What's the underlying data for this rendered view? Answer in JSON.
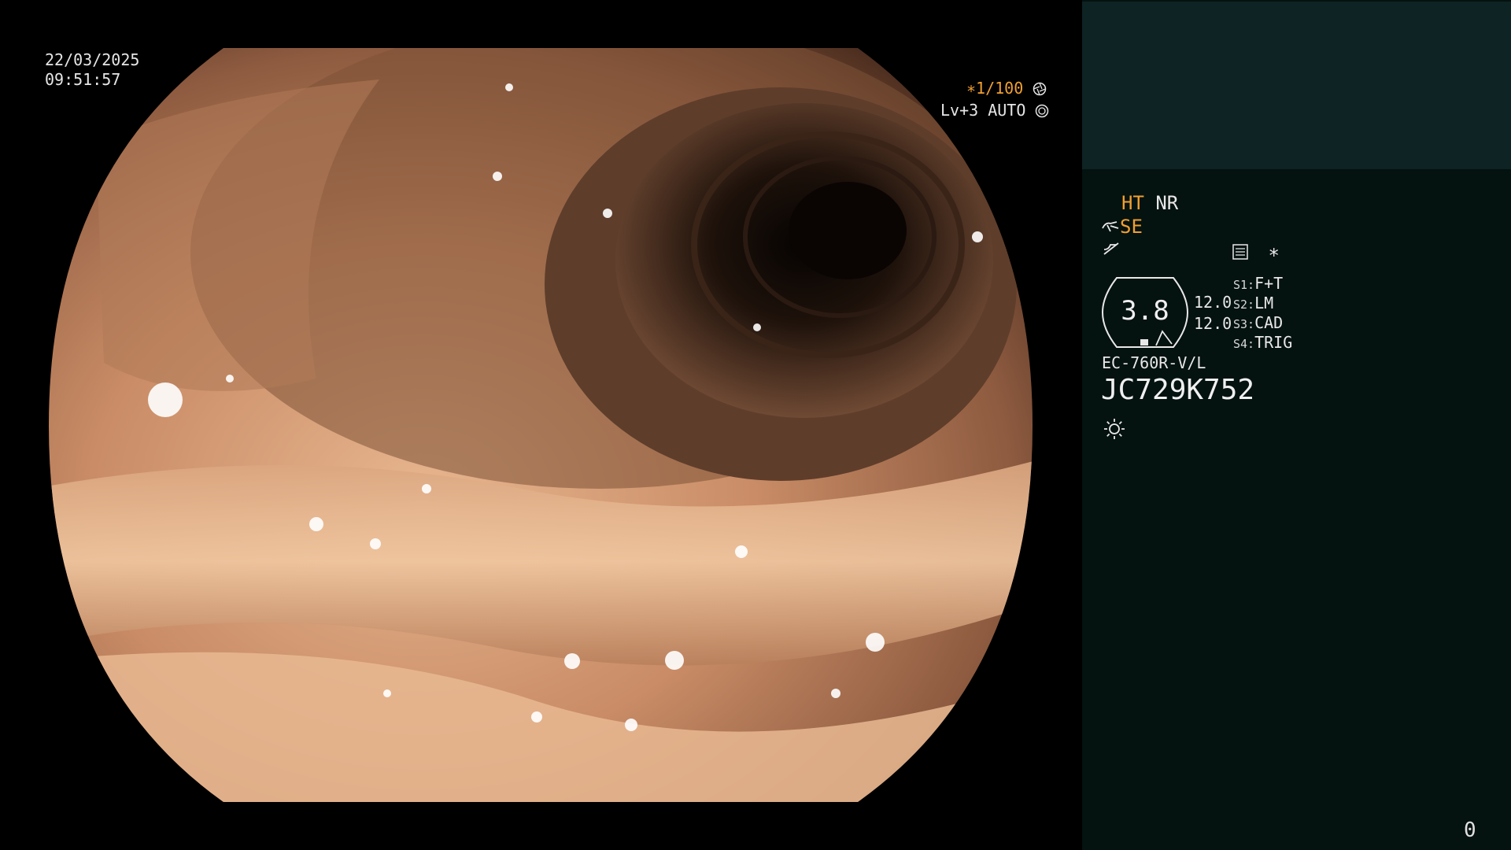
{
  "overlay": {
    "date": "22/03/2025",
    "time": "09:51:57",
    "shutter": "∗1/100",
    "level": "Lv+3 AUTO"
  },
  "panel": {
    "ht": "HT",
    "nr": "NR",
    "se": "SE",
    "asterisk": "∗",
    "gauge_value": "3.8",
    "param_1": "12.0",
    "param_2": "12.0",
    "switches": [
      {
        "key": "S1:",
        "value": "F+T"
      },
      {
        "key": "S2:",
        "value": "LM"
      },
      {
        "key": "S3:",
        "value": "CAD"
      },
      {
        "key": "S4:",
        "value": "TRIG"
      }
    ],
    "scope_model": "EC-760R-V/L",
    "serial_number": "JC729K752"
  },
  "counter": "0",
  "colors": {
    "osd_amber": "#f0a030",
    "panel_bg": "#041210",
    "panel_top_bg": "#0d2324"
  },
  "icons": [
    "shutter-icon",
    "level-icon",
    "hand-icon",
    "slope-icon",
    "menu-icon",
    "sun-icon"
  ]
}
